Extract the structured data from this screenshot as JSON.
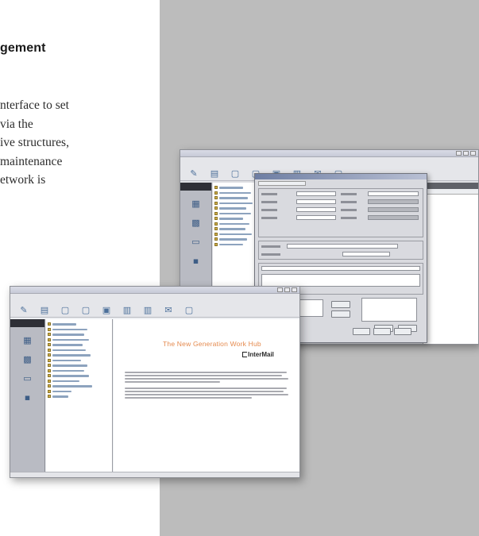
{
  "text": {
    "heading": "gement",
    "lines": [
      "nterface to set",
      "via the",
      "ive structures,",
      "maintenance",
      "etwork is"
    ]
  },
  "front_window": {
    "content_title": "The New Generation Work Hub",
    "logo": "InterMail"
  },
  "colors": {
    "panel_grey": "#bcbcbc",
    "content_title": "#e58a4e"
  }
}
